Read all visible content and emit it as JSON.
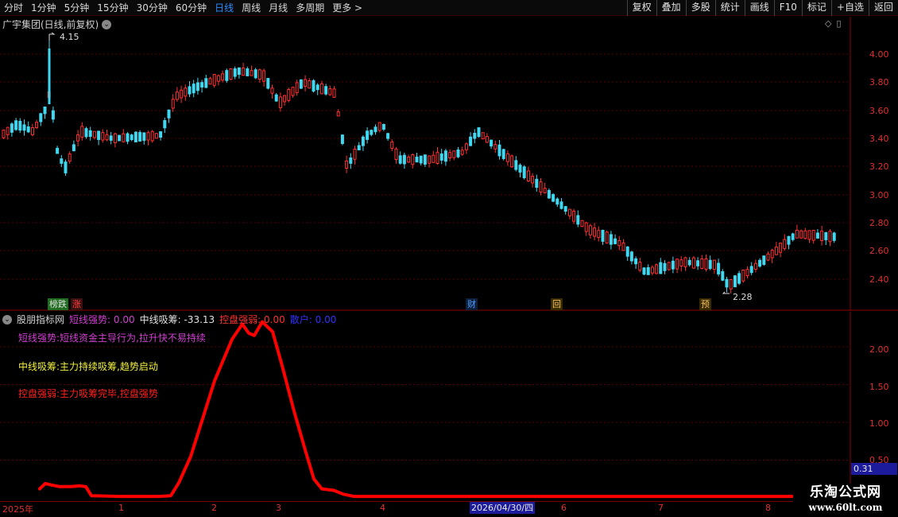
{
  "toolbar": {
    "periods": [
      "分时",
      "1分钟",
      "5分钟",
      "15分钟",
      "30分钟",
      "60分钟",
      "日线",
      "周线",
      "月线",
      "多周期",
      "更多 >"
    ],
    "active_period": "日线",
    "actions": [
      "复权",
      "叠加",
      "多股",
      "统计",
      "画线",
      "F10",
      "标记",
      "+自选",
      "返回"
    ]
  },
  "main_chart": {
    "title": "广宇集团(日线,前复权)",
    "high_label": "4.15",
    "low_label": "2.28",
    "price_ticks": [
      "4.00",
      "3.80",
      "3.60",
      "3.40",
      "3.20",
      "3.00",
      "2.80",
      "2.60",
      "2.40"
    ],
    "badges": [
      {
        "text": "榜跌",
        "color": "#e0e0e0",
        "bg": "#1f6b1f"
      },
      {
        "text": "涨",
        "color": "#ff4040",
        "bg": "#3a1010"
      },
      {
        "text": "财",
        "color": "#4f9dff",
        "bg": "#0d1f3a"
      },
      {
        "text": "回",
        "color": "#f0c060",
        "bg": "#3a2a00"
      },
      {
        "text": "预",
        "color": "#f0c060",
        "bg": "#3a2a00"
      }
    ]
  },
  "indicator": {
    "name": "股朋指标网",
    "values": [
      {
        "label": "短线强势:",
        "value": "0.00",
        "color": "#d040d0"
      },
      {
        "label": "中线吸筹:",
        "value": "-33.13",
        "color": "#e0e0e0"
      },
      {
        "label": "控盘强弱:",
        "value": "0.00",
        "color": "#ff3030"
      },
      {
        "label": "散户:",
        "value": "0.00",
        "color": "#3030ff"
      }
    ],
    "descriptions": [
      {
        "text": "短线强势:短线资金主导行为,拉升快不易持续",
        "color": "#d040d0"
      },
      {
        "text": "中线吸筹:主力持续吸筹,趋势启动",
        "color": "#f0f040"
      },
      {
        "text": "控盘强弱:主力吸筹完毕,控盘强势",
        "color": "#ff2020"
      }
    ],
    "ticks": [
      "2.00",
      "1.50",
      "1.00",
      "0.50"
    ],
    "current_value": "0.31"
  },
  "chart_data": {
    "type": "line",
    "x": [
      0,
      4,
      7,
      10,
      13,
      16,
      19,
      22,
      25,
      28,
      31,
      34,
      37,
      40,
      43,
      46,
      49,
      52,
      55,
      58,
      61,
      64,
      67,
      70,
      73,
      76,
      79,
      82,
      85,
      88,
      91,
      94,
      97,
      100,
      103,
      106,
      109,
      112,
      115,
      118,
      121,
      124,
      127,
      130,
      133,
      136,
      139,
      142,
      145,
      148,
      151,
      154,
      157,
      160,
      163,
      166,
      169,
      172,
      175,
      178,
      181,
      184,
      187,
      190,
      193,
      196,
      199,
      202,
      205,
      208,
      211,
      214,
      217,
      220,
      223,
      226,
      229,
      232,
      235,
      238,
      241,
      244,
      247,
      250,
      253,
      256,
      259,
      262,
      265,
      268,
      271,
      274,
      277,
      280,
      283,
      286,
      289,
      292,
      295,
      298,
      301,
      304,
      307,
      310,
      313
    ],
    "series": [
      {
        "color": "#ff0000",
        "values": [
          0,
          0.18,
          0.14,
          0.12,
          0.12,
          0.12,
          0.12,
          0.0,
          0.0,
          0.0,
          0.0,
          0.0,
          0.0,
          0.0,
          0.0,
          0.0,
          0.0,
          0.0,
          0.0,
          0.0,
          0.0,
          0.0,
          0.0,
          0.0,
          0.0,
          0.0,
          0.0,
          0.0,
          0.0,
          0.0,
          0.0,
          0.0,
          0.0,
          0.0,
          0.0,
          0.0,
          0.0,
          0.0,
          0.0,
          0.0,
          0.0,
          0.0,
          0.0,
          0.0,
          0.0,
          0.0,
          0.0,
          0.0,
          0.0,
          0.0,
          0.0,
          0.0,
          0.0,
          0.0,
          0.0,
          0.0,
          0.0,
          0.0,
          0.0,
          0.0,
          0.0,
          0.0,
          0.0,
          0.0,
          0.0,
          0.0,
          0.0,
          0.0,
          0.0,
          0.0,
          0.0,
          0.0,
          0.0,
          0.0,
          0.0,
          0.0,
          0.0,
          0.0,
          0.0,
          0.0,
          0.0,
          0.0,
          0.0,
          0.0,
          0.0,
          0.0,
          0.0,
          0.0,
          0.0,
          0.0,
          0.0,
          0.0,
          0.0,
          0.0,
          0.0,
          0.0,
          0.0,
          0.0,
          0.0,
          0.0,
          0.0,
          0.0,
          0.0,
          0.0,
          0.0
        ]
      }
    ],
    "y_ticks": [
      0.5,
      1.0,
      1.5,
      2.0
    ],
    "ylim": [
      0,
      2.4
    ],
    "grid": true
  },
  "xaxis": {
    "labels": [
      "2025年",
      "1",
      "2",
      "3",
      "4",
      "6",
      "7",
      "8"
    ],
    "cursor_date": "2026/04/30/四"
  },
  "watermark": {
    "line1": "乐淘公式网",
    "line2": "www.60lt.com"
  }
}
